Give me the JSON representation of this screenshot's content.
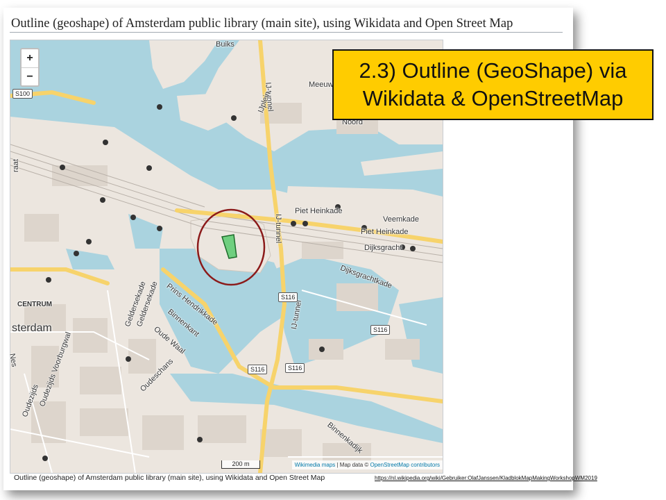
{
  "page": {
    "heading": "Outline (geoshape) of Amsterdam public library (main site), using Wikidata and Open Street Map",
    "caption": "Outline (geoshape) of Amsterdam public library (main site), using Wikidata and Open Street Map",
    "source_url": "https://nl.wikipedia.org/wiki/Gebruiker:OlafJanssen/KladblokMapMakingWorkshopWM2019"
  },
  "callout": {
    "line1": "2.3) Outline (GeoShape) via",
    "line2": "Wikidata & OpenStreetMap",
    "color": "#ffcc00"
  },
  "map": {
    "zoom_in": "+",
    "zoom_out": "−",
    "scale": "200 m",
    "attribution_maps": "Wikimedia maps",
    "attribution_sep": " | Map data © ",
    "attribution_osm": "OpenStreetMap contributors",
    "colors": {
      "water": "#aad3df",
      "land": "#ece6df",
      "buildings": "#ddd5cc",
      "major_road": "#f7d36b",
      "highlight_fill": "#6fcf7f",
      "highlight_circle": "#8b1a1a"
    },
    "labels": {
      "centrum": "CENTRUM",
      "sterdam": "sterdam",
      "piet_heinkade_1": "Piet Heinkade",
      "piet_heinkade_2": "Piet Heinkade",
      "veemkade": "Veemkade",
      "dijksgracht": "Dijksgracht",
      "dijksgrachtkade": "Dijksgrachtkade",
      "ij_tunnel_1": "IJ-tunnel",
      "ij_tunnel_2": "IJ-tunnel",
      "ij_tunnel_3": "IJ-tunnel",
      "ijplein": "IJplein",
      "meeuw": "Meeuw",
      "noord": "Noord",
      "buiks": "Buiks",
      "prins_hendrikkade": "Prins Hendrikkade",
      "binnenkant": "Binnenkant",
      "oude_waal": "Oude Waal",
      "oudeschans": "Oudeschans",
      "geldersekade_1": "Geldersekade",
      "geldersekade_2": "Geldersekade",
      "binnenkadijk": "Binnenkadijk",
      "raat": "raat",
      "nes": "Nes",
      "oudezijds_voorburgwal": "Oudezijds Voorburgwal",
      "oudezijds": "Oudezijds"
    },
    "shields": {
      "s100": "S100",
      "s116_a": "S116",
      "s116_b": "S116",
      "s116_c": "S116",
      "s116_d": "S116"
    }
  }
}
